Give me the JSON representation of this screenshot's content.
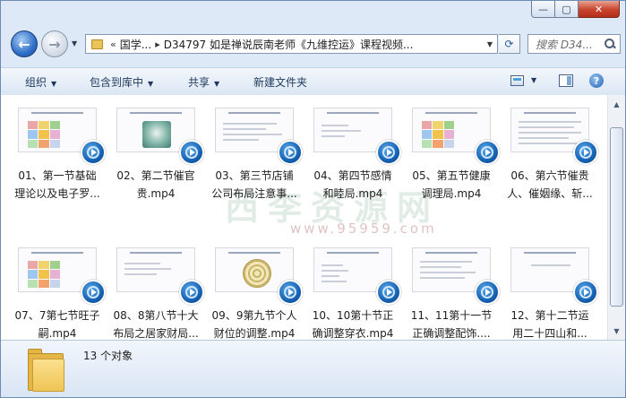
{
  "window": {
    "minimize_label": "—",
    "maximize_label": "▢",
    "close_label": "✕"
  },
  "address": {
    "history_symbol": "«",
    "crumb1": "国学...",
    "crumb_sep": "▸",
    "crumb2": "D34797 如是禅说辰南老师《九维控运》课程视频..."
  },
  "search": {
    "placeholder": "搜索 D34..."
  },
  "toolbar": {
    "organize": "组织",
    "include_library": "包含到库中",
    "share": "共享",
    "new_folder": "新建文件夹"
  },
  "watermark": {
    "main": "西李资源网",
    "url": "www.95959.com"
  },
  "files": [
    {
      "name": "01、第一节基础理论以及电子罗..."
    },
    {
      "name": "02、第二节催官贵.mp4"
    },
    {
      "name": "03、第三节店铺公司布局注意事..."
    },
    {
      "name": "04、第四节感情和睦局.mp4"
    },
    {
      "name": "05、第五节健康调理局.mp4"
    },
    {
      "name": "06、第六节催贵人、催姻缘、斩..."
    },
    {
      "name": "07、7第七节旺子嗣.mp4"
    },
    {
      "name": "08、8第八节十大布局之居家财局..."
    },
    {
      "name": "09、9第九节个人财位的调整.mp4"
    },
    {
      "name": "10、10第十节正确调整穿衣.mp4"
    },
    {
      "name": "11、11第十一节正确调整配饰...."
    },
    {
      "name": "12、第十二节运用二十四山和..."
    }
  ],
  "status": {
    "count": "13 个对象"
  },
  "colors": {
    "accent": "#1e395b",
    "window_frame": "#dde9f6",
    "close_red": "#c8432b"
  }
}
